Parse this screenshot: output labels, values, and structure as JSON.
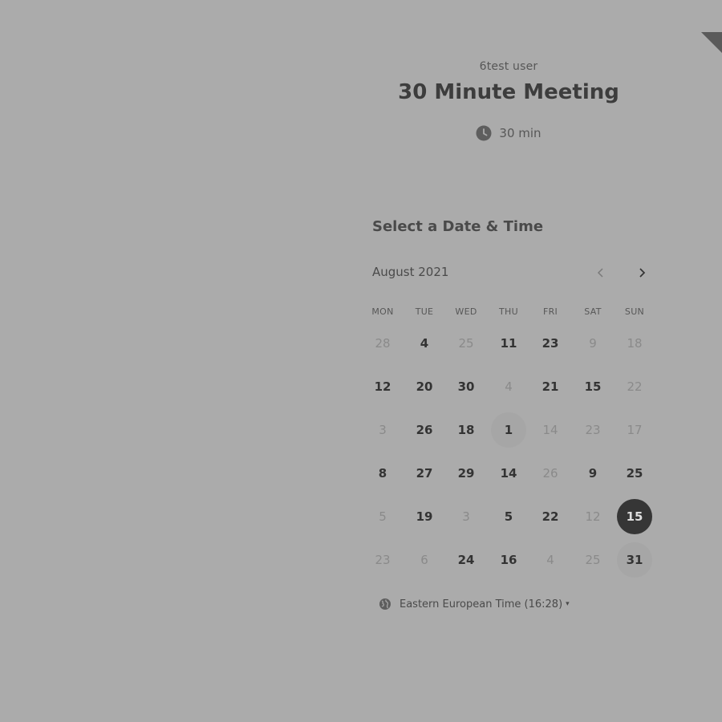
{
  "header": {
    "organizer": "6test user",
    "event_title": "30 Minute Meeting",
    "duration": "30 min",
    "duration_icon": "clock-icon"
  },
  "calendar": {
    "section_title": "Select a Date & Time",
    "month": "August 2021",
    "prev_icon": "chevron-left-icon",
    "next_icon": "chevron-right-icon",
    "weekdays": [
      "MON",
      "TUE",
      "WED",
      "THU",
      "FRI",
      "SAT",
      "SUN"
    ],
    "weeks": [
      [
        {
          "d": "28",
          "a": false
        },
        {
          "d": "4",
          "a": true
        },
        {
          "d": "25",
          "a": false
        },
        {
          "d": "11",
          "a": true
        },
        {
          "d": "23",
          "a": true
        },
        {
          "d": "9",
          "a": false
        },
        {
          "d": "18",
          "a": false
        }
      ],
      [
        {
          "d": "12",
          "a": true
        },
        {
          "d": "20",
          "a": true
        },
        {
          "d": "30",
          "a": true
        },
        {
          "d": "4",
          "a": false
        },
        {
          "d": "21",
          "a": true
        },
        {
          "d": "15",
          "a": true
        },
        {
          "d": "22",
          "a": false
        }
      ],
      [
        {
          "d": "3",
          "a": false
        },
        {
          "d": "26",
          "a": true
        },
        {
          "d": "18",
          "a": true
        },
        {
          "d": "1",
          "a": true,
          "today": true
        },
        {
          "d": "14",
          "a": false
        },
        {
          "d": "23",
          "a": false
        },
        {
          "d": "17",
          "a": false
        }
      ],
      [
        {
          "d": "8",
          "a": true
        },
        {
          "d": "27",
          "a": true
        },
        {
          "d": "29",
          "a": true
        },
        {
          "d": "14",
          "a": true
        },
        {
          "d": "26",
          "a": false
        },
        {
          "d": "9",
          "a": true
        },
        {
          "d": "25",
          "a": true
        }
      ],
      [
        {
          "d": "5",
          "a": false
        },
        {
          "d": "19",
          "a": true
        },
        {
          "d": "3",
          "a": false
        },
        {
          "d": "5",
          "a": true
        },
        {
          "d": "22",
          "a": true
        },
        {
          "d": "12",
          "a": false
        },
        {
          "d": "15",
          "a": true,
          "selected": true
        }
      ],
      [
        {
          "d": "23",
          "a": false
        },
        {
          "d": "6",
          "a": false
        },
        {
          "d": "24",
          "a": true
        },
        {
          "d": "16",
          "a": true
        },
        {
          "d": "4",
          "a": false
        },
        {
          "d": "25",
          "a": false
        },
        {
          "d": "31",
          "a": true,
          "today": true
        }
      ]
    ]
  },
  "timezone": {
    "label": "Eastern European Time (16:28)",
    "icon": "globe-icon"
  },
  "colors": {
    "background": "#ababab",
    "selected_day": "#363636",
    "text": "#3a3a3a"
  }
}
